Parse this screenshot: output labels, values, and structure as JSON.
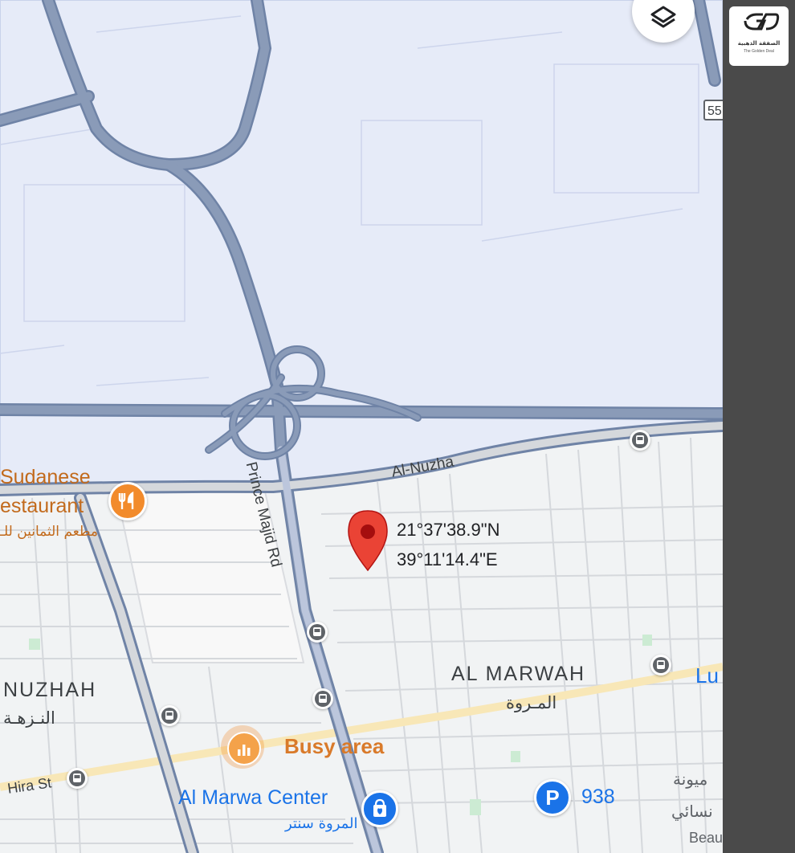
{
  "map": {
    "pin": {
      "lat": "21°37'38.9\"N",
      "lon": "39°11'14.4\"E",
      "color": "#ea4335"
    },
    "colors": {
      "zone_fill": "#e6ebf8",
      "road": "#8a9bb8",
      "road_outline": "#6f83a6",
      "background": "#f1f3f4",
      "poi_orange": "#f28b2c",
      "transit_blue": "#1a73e8"
    },
    "streets": {
      "al_nuzha": "Al-Nuzha",
      "prince_majid": "Prince Majid Rd",
      "hira": "Hira St"
    },
    "districts": {
      "al_marwah_en": "AL MARWAH",
      "al_marwah_ar": "المـروة",
      "nuzhah_en": "NUZHAH",
      "nuzhah_ar": "النـزهـة"
    },
    "pois": {
      "sudanese_line1": "Sudanese",
      "sudanese_line2": "estaurant",
      "sudanese_ar": "مطعم الثمانين للـ",
      "sudanese_icon": "restaurant-icon",
      "busy_area": "Busy area",
      "busy_icon": "bar-chart-icon",
      "marwa_center": "Al Marwa Center",
      "marwa_center_ar": "المروة سنتر",
      "marwa_icon": "shopping-bag-icon",
      "parking_label": "938",
      "parking_icon": "parking-icon",
      "lulu_partial": "Lu",
      "right_ar1": "ميونة",
      "right_ar2": "نسائي",
      "beau_partial": "Beau"
    },
    "route_shield": "55",
    "controls": {
      "layers_icon": "layers-icon"
    },
    "transit_icon": "bus-stop-icon"
  },
  "sidebar": {
    "logo_ar": "الصفقة الذهبية",
    "logo_en": "The Golden Deal",
    "background": "#4a4a4a"
  }
}
